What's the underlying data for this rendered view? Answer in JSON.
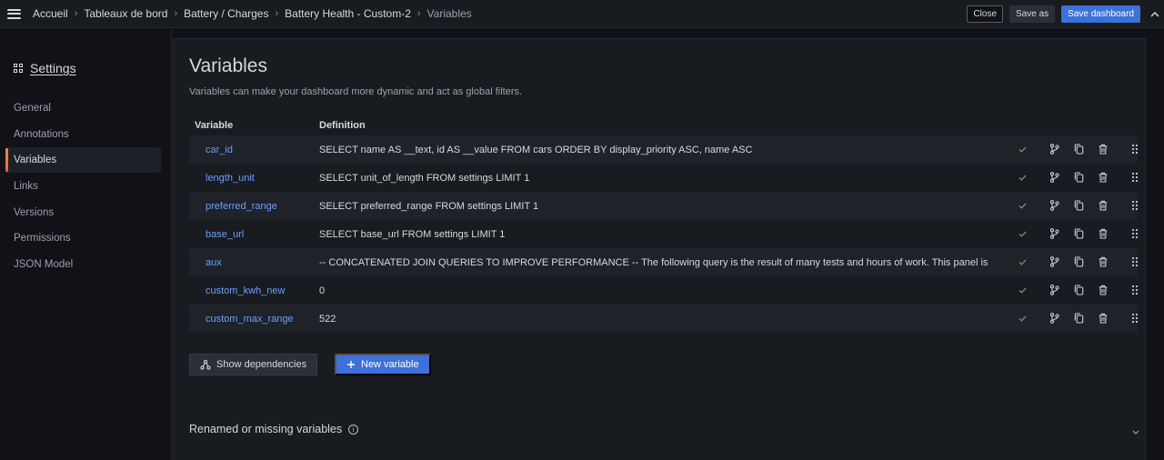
{
  "breadcrumb": [
    {
      "label": "Accueil"
    },
    {
      "label": "Tableaux de bord"
    },
    {
      "label": "Battery / Charges"
    },
    {
      "label": "Battery Health - Custom-2"
    },
    {
      "label": "Variables"
    }
  ],
  "toolbar": {
    "close_label": "Close",
    "save_as_label": "Save as",
    "save_dashboard_label": "Save dashboard"
  },
  "sidebar": {
    "title": "Settings",
    "items": [
      {
        "label": "General"
      },
      {
        "label": "Annotations"
      },
      {
        "label": "Variables",
        "active": true
      },
      {
        "label": "Links"
      },
      {
        "label": "Versions"
      },
      {
        "label": "Permissions"
      },
      {
        "label": "JSON Model"
      }
    ]
  },
  "main": {
    "title": "Variables",
    "subtitle": "Variables can make your dashboard more dynamic and act as global filters.",
    "table": {
      "headers": {
        "variable": "Variable",
        "definition": "Definition"
      },
      "rows": [
        {
          "name": "car_id",
          "definition": "SELECT name AS __text, id AS __value FROM cars ORDER BY display_priority ASC, name ASC"
        },
        {
          "name": "length_unit",
          "definition": "SELECT unit_of_length FROM settings LIMIT 1"
        },
        {
          "name": "preferred_range",
          "definition": "SELECT preferred_range FROM settings LIMIT 1"
        },
        {
          "name": "base_url",
          "definition": "SELECT base_url FROM settings LIMIT 1"
        },
        {
          "name": "aux",
          "definition": "-- CONCATENATED JOIN QUERIES TO IMPROVE PERFORMANCE -- The following query is the result of many tests and hours of work. This panel is"
        },
        {
          "name": "custom_kwh_new",
          "definition": "0"
        },
        {
          "name": "custom_max_range",
          "definition": "522"
        }
      ]
    },
    "show_dependencies_label": "Show dependencies",
    "new_variable_label": "New variable",
    "renamed_label": "Renamed or missing variables"
  },
  "colors": {
    "accent": "#3d71d9",
    "link": "#6e9fff",
    "ok": "#56a64b",
    "active_bar": "#ff8833"
  }
}
